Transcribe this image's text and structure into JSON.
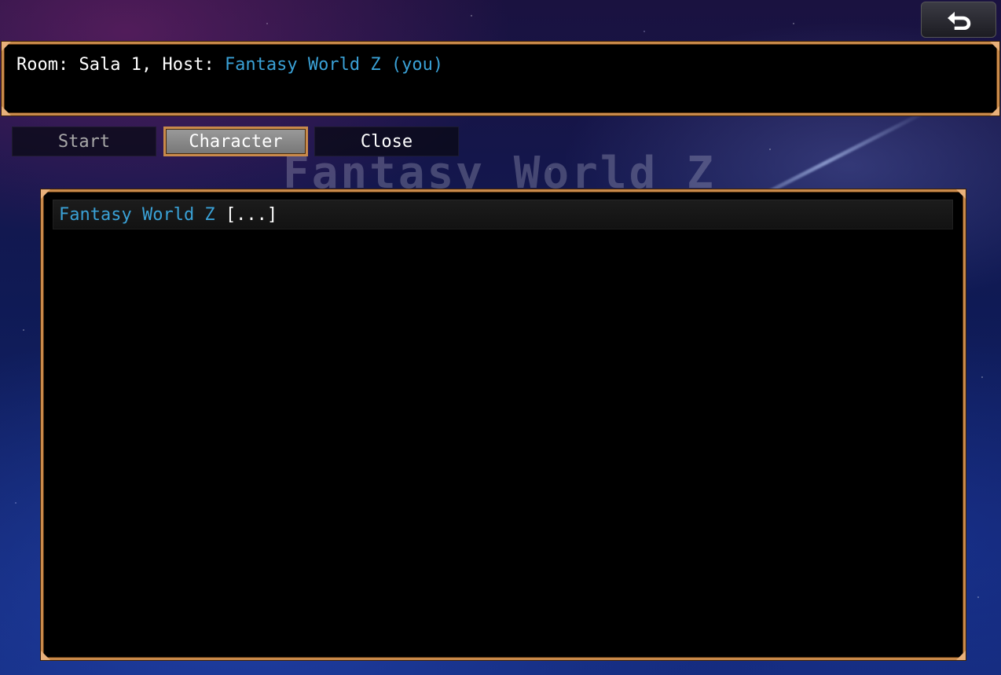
{
  "background": {
    "title_text": "Fantasy World Z"
  },
  "toolbar": {
    "back_icon": "return-arrow-icon"
  },
  "header": {
    "room_prefix": "Room: ",
    "room_name": "Sala 1",
    "host_prefix": ", Host: ",
    "host_name": "Fantasy World Z (you)"
  },
  "commands": [
    {
      "label": "Start",
      "enabled": false
    },
    {
      "label": "Character",
      "selected": true
    },
    {
      "label": "Close"
    }
  ],
  "players": [
    {
      "name": "Fantasy World Z",
      "tag": "[...]"
    }
  ],
  "colors": {
    "frame": "#c98a4b",
    "host_highlight": "#3aa1d6",
    "text": "#ffffff",
    "disabled_text": "#a8a8a8"
  }
}
